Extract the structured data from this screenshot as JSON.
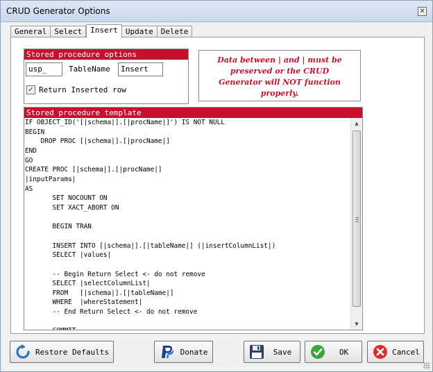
{
  "window": {
    "title": "CRUD Generator Options",
    "close_glyph": "✕"
  },
  "tabs": [
    {
      "label": "General",
      "active": false
    },
    {
      "label": "Select",
      "active": false
    },
    {
      "label": "Insert",
      "active": true
    },
    {
      "label": "Update",
      "active": false
    },
    {
      "label": "Delete",
      "active": false
    }
  ],
  "sp_options": {
    "header": "Stored procedure options",
    "prefix_value": "usp_",
    "tablename_label": "TableName",
    "tablename_value": "Insert",
    "return_checked": true,
    "return_label": "Return Inserted row"
  },
  "warning": {
    "line1": "Data between | and | must be",
    "line2": "preserved or the CRUD",
    "line3": "Generator will NOT function",
    "line4": "properly."
  },
  "template": {
    "header": "Stored procedure template",
    "code": "IF OBJECT_ID('[|schema|].[|procName|]') IS NOT NULL\nBEGIN\n    DROP PROC [|schema|].[|procName|]\nEND\nGO\nCREATE PROC [|schema|].[|procName|]\n|inputParams|\nAS\n       SET NOCOUNT ON\n       SET XACT_ABORT ON\n\n       BEGIN TRAN\n\n       INSERT INTO [|schema|].[|tableName|] (|insertColumnList|)\n       SELECT |values|\n\n       -- Begin Return Select <- do not remove\n       SELECT |selectColumnList|\n       FROM   [|schema|].[|tableName|]\n       WHERE  |whereStatement|\n       -- End Return Select <- do not remove\n\n       COMMIT"
  },
  "buttons": {
    "restore": "Restore Defaults",
    "donate": "Donate",
    "save": "Save",
    "ok": "OK",
    "cancel": "Cancel"
  },
  "icons": {
    "close": "close-icon",
    "restore": "refresh-icon",
    "donate": "paypal-icon",
    "save": "floppy-disk-icon",
    "ok": "checkmark-icon",
    "cancel": "cancel-icon"
  },
  "colors": {
    "accent_red": "#c8102e",
    "ok_green": "#3aa63a",
    "cancel_red": "#d9302a",
    "restore_blue": "#2f6fc0",
    "paypal_blue": "#1f3f8a"
  }
}
